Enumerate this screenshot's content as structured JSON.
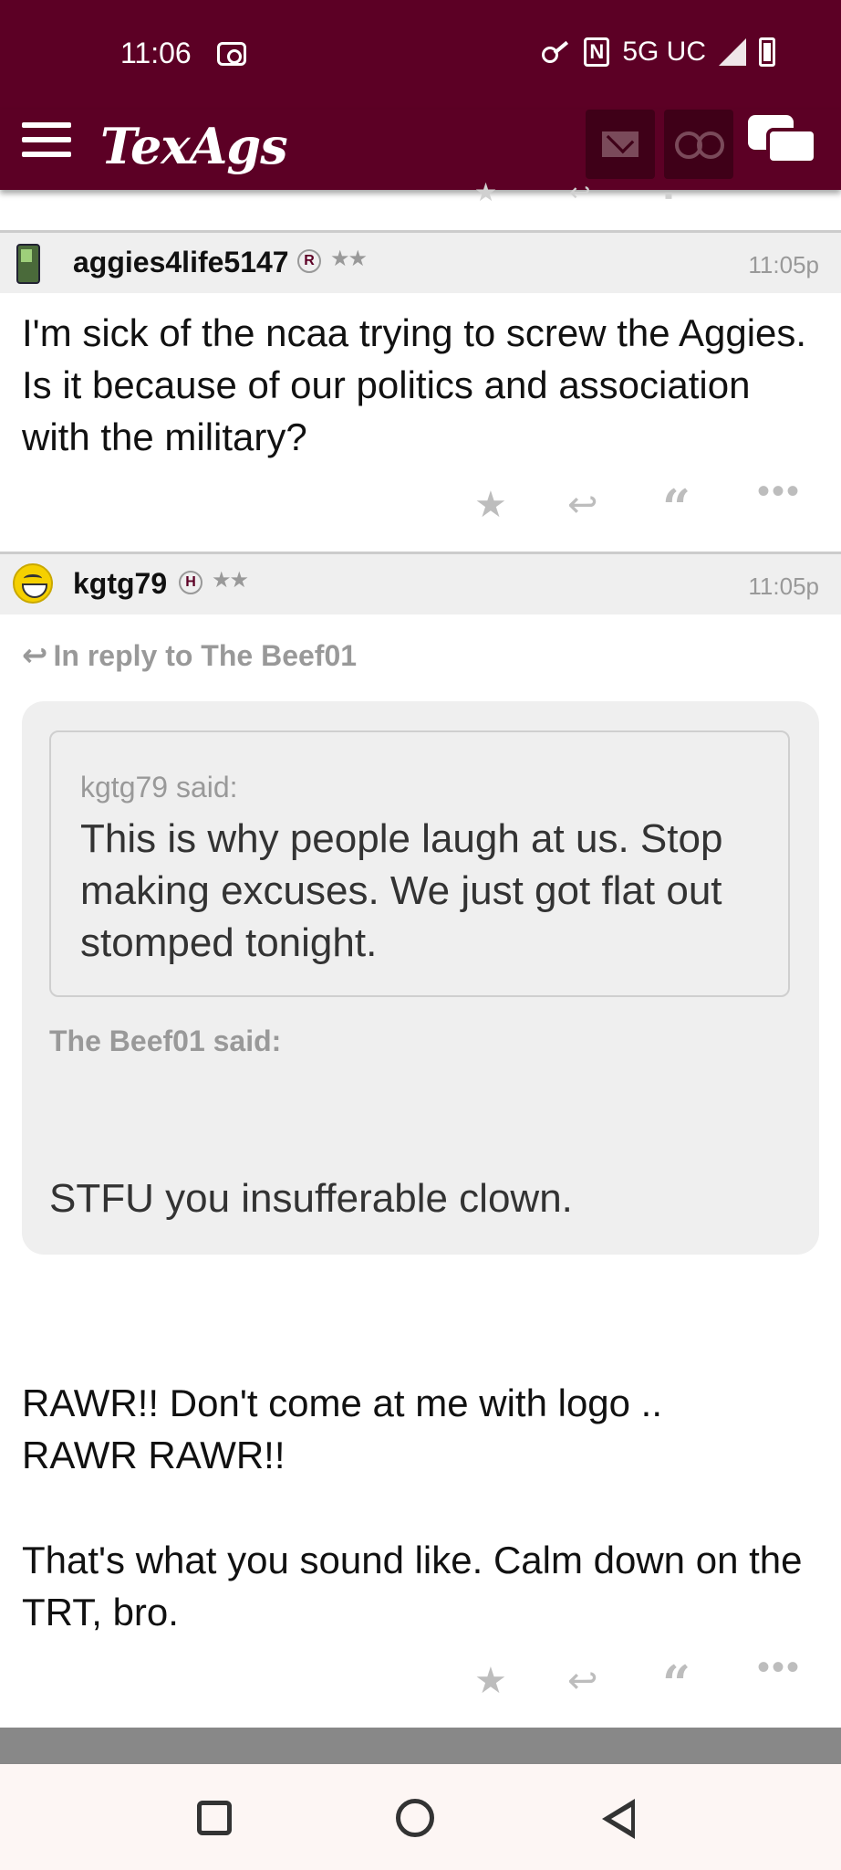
{
  "status_bar": {
    "time": "11:06",
    "network": "5G UC"
  },
  "header": {
    "logo": "TexAgs"
  },
  "posts": [
    {
      "username": "aggies4life5147",
      "badge": "R",
      "stars": "★★",
      "timestamp": "11:05p",
      "body": "I'm sick of the ncaa trying to screw the Aggies. Is it because of our politics and association with the military?"
    },
    {
      "username": "kgtg79",
      "badge": "H",
      "stars": "★★",
      "timestamp": "11:05p",
      "in_reply_to": "In reply to The Beef01",
      "quote_inner_author": "kgtg79 said:",
      "quote_inner_text": "This is why people laugh at us. Stop making excuses. We just got flat out stomped tonight.",
      "quote_outer_author": "The Beef01 said:",
      "quote_outer_text": "STFU you insufferable clown.",
      "body_line1": "RAWR!! Don't come at me with logo ..",
      "body_line2": "RAWR RAWR!!",
      "body_line3": "That's what you sound like. Calm down on the TRT, bro."
    }
  ],
  "actions": {
    "star": "★",
    "reply": "↩",
    "quote": "“",
    "more": "•••"
  },
  "colors": {
    "brand": "#5c0025",
    "header_dark": "#3f0018"
  }
}
